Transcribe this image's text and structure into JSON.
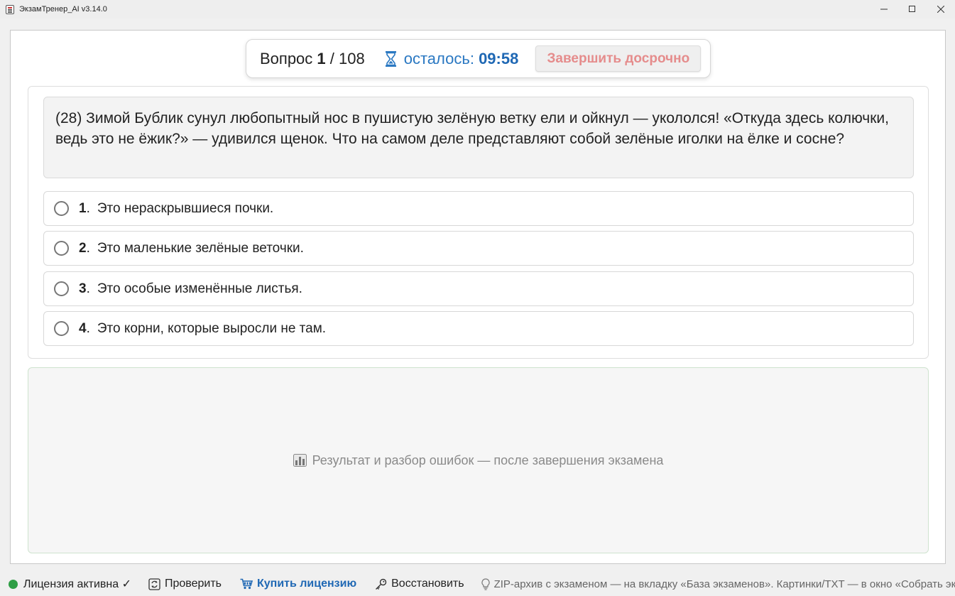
{
  "window": {
    "title": "ЭкзамТренер_AI v3.14.0"
  },
  "header": {
    "question_label": "Вопрос",
    "question_current": "1",
    "question_total": "/ 108",
    "timer_label": "осталось:",
    "timer_value": "09:58",
    "finish_button": "Завершить досрочно"
  },
  "question": {
    "text": "(28) Зимой Бублик сунул любопытный нос в пушистую зелёную ветку ели и ойкнул — укололся! «Откуда здесь колючки, ведь это не ёжик?» — удивился щенок. Что на самом деле представляют собой зелёные иголки на ёлке и сосне?"
  },
  "answers": [
    {
      "num": "1",
      "text": "Это нераскрывшиеся почки."
    },
    {
      "num": "2",
      "text": "Это маленькие зелёные веточки."
    },
    {
      "num": "3",
      "text": "Это особые изменённые листья."
    },
    {
      "num": "4",
      "text": "Это корни, которые выросли не там."
    }
  ],
  "result": {
    "message": "Результат и разбор ошибок — после завершения экзамена",
    "icon": "bar-chart-icon"
  },
  "statusbar": {
    "license_status": "Лицензия активна ✓",
    "check_label": "Проверить",
    "buy_label": "Купить лицензию",
    "restore_label": "Восстановить",
    "hint": "ZIP-архив с экзаменом — на вкладку «База экзаменов». Картинки/TXT — в окно «Собрать экзаме"
  },
  "colors": {
    "accent_blue": "#1f68b4",
    "finish_red": "#e58c8c",
    "license_green": "#2e9e45"
  }
}
